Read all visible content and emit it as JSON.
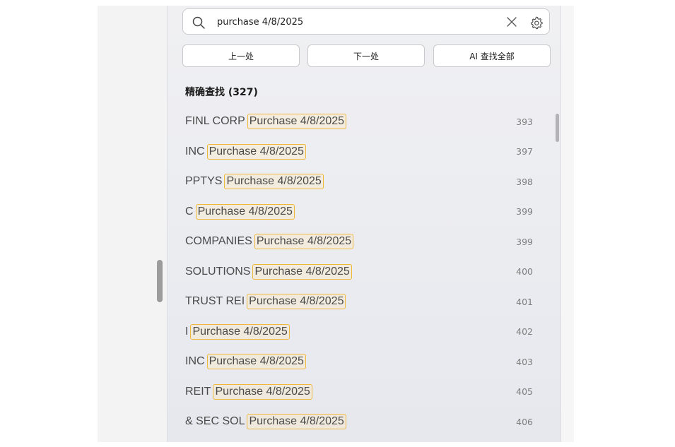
{
  "search": {
    "value": "purchase 4/8/2025"
  },
  "buttons": {
    "prev_label": "上一处",
    "next_label": "下一处",
    "ai_label": "AI 查找全部"
  },
  "section": {
    "title": "精确查找 (327)"
  },
  "results": [
    {
      "prefix": "FINL CORP",
      "match": "Purchase 4/8/2025",
      "page": "393"
    },
    {
      "prefix": "INC",
      "match": "Purchase 4/8/2025",
      "page": "397"
    },
    {
      "prefix": "PPTYS",
      "match": "Purchase 4/8/2025",
      "page": "398"
    },
    {
      "prefix": "C",
      "match": "Purchase 4/8/2025",
      "page": "399"
    },
    {
      "prefix": "COMPANIES",
      "match": "Purchase 4/8/2025",
      "page": "399"
    },
    {
      "prefix": "SOLUTIONS",
      "match": "Purchase 4/8/2025",
      "page": "400"
    },
    {
      "prefix": "TRUST REI",
      "match": "Purchase 4/8/2025",
      "page": "401"
    },
    {
      "prefix": "I",
      "match": "Purchase 4/8/2025",
      "page": "402"
    },
    {
      "prefix": "INC",
      "match": "Purchase 4/8/2025",
      "page": "403"
    },
    {
      "prefix": "REIT",
      "match": "Purchase 4/8/2025",
      "page": "405"
    },
    {
      "prefix": "& SEC SOL",
      "match": "Purchase 4/8/2025",
      "page": "406"
    }
  ],
  "colors": {
    "highlight_border": "#f0b73a",
    "panel_background": "#eceef1"
  },
  "icons": {
    "search": "search-icon",
    "close": "close-icon",
    "settings": "gear-icon"
  }
}
